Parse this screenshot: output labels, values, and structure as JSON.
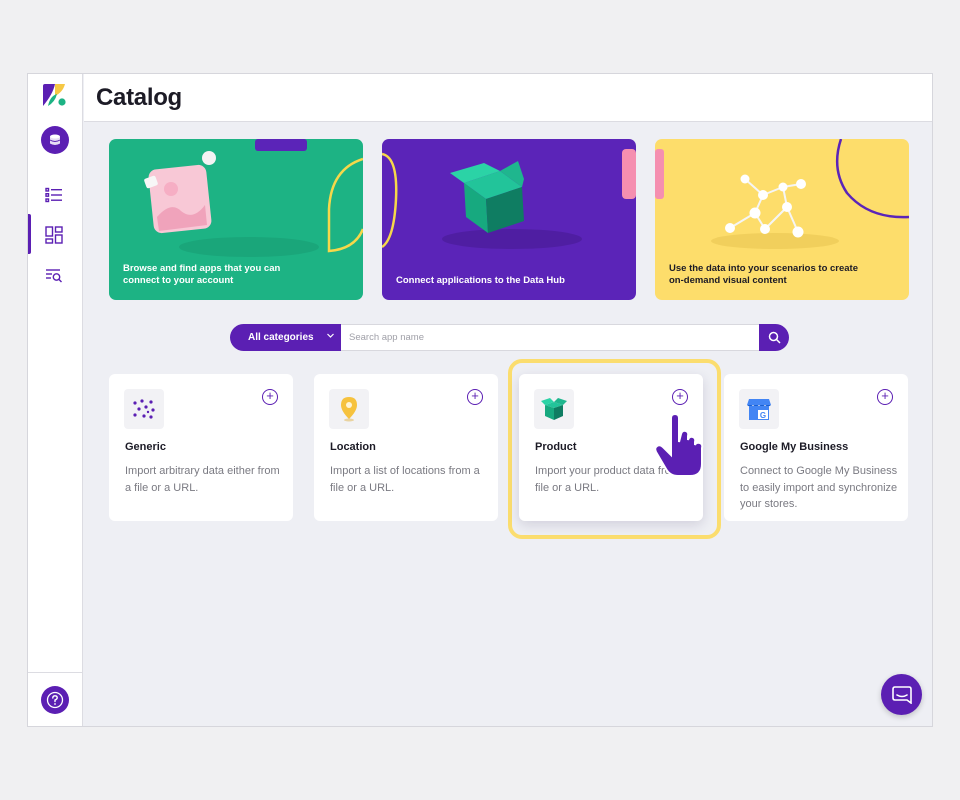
{
  "header": {
    "title": "Catalog"
  },
  "sidebar": {
    "items": [
      {
        "icon": "database-icon"
      },
      {
        "icon": "list-icon"
      },
      {
        "icon": "dashboard-icon"
      },
      {
        "icon": "search-list-icon"
      },
      {
        "icon": "help-icon"
      }
    ],
    "active_item": "dashboard-icon"
  },
  "banners": [
    {
      "text": "Browse and find apps that you can connect to your account",
      "color": "#1db384"
    },
    {
      "text": "Connect applications to the Data Hub",
      "color": "#5b24b8"
    },
    {
      "text": "Use the data into your scenarios to create on-demand visual content",
      "color": "#fddd6b"
    }
  ],
  "search": {
    "category_label": "All categories",
    "placeholder": "Search app name"
  },
  "cards": [
    {
      "title": "Generic",
      "description": "Import arbitrary data either from a file or a URL.",
      "icon": "scatter-dots-icon"
    },
    {
      "title": "Location",
      "description": "Import a list of locations from a file or a URL.",
      "icon": "map-pin-icon"
    },
    {
      "title": "Product",
      "description": "Import your product data from a file or a URL.",
      "icon": "open-box-icon"
    },
    {
      "title": "Google My Business",
      "description": "Connect to Google My Business to easily import and synchronize your stores.",
      "icon": "google-my-business-icon"
    }
  ],
  "colors": {
    "accent": "#5b1fb3",
    "highlight": "#fbdd6e"
  }
}
